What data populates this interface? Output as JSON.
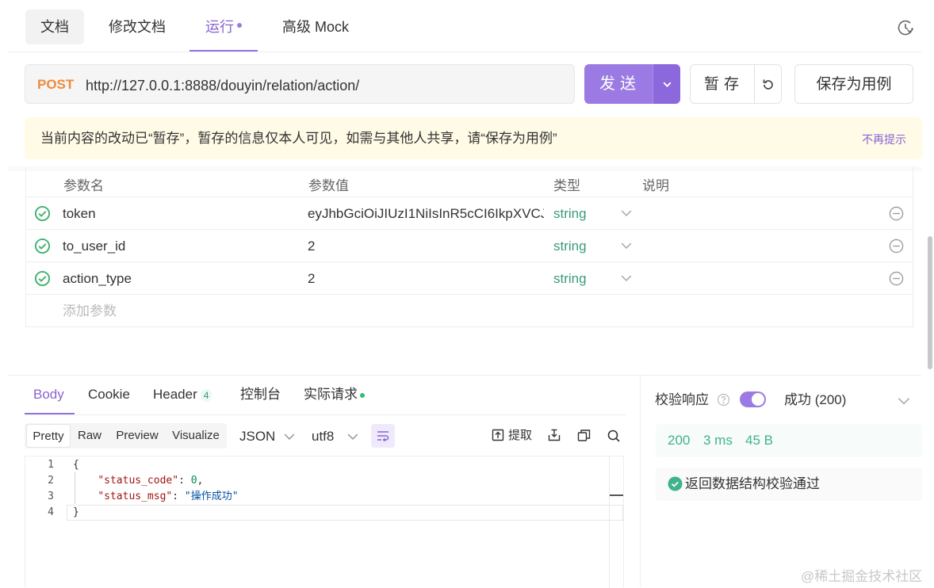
{
  "top_tabs": {
    "doc": "文档",
    "edit_doc": "修改文档",
    "run": "运行",
    "mock": "高级 Mock",
    "history_icon": "history-clock-icon"
  },
  "request": {
    "method": "POST",
    "url": "http://127.0.0.1:8888/douyin/relation/action/",
    "send_label": "发送",
    "stash_label": "暂存",
    "save_case_label": "保存为用例"
  },
  "notice": {
    "text": "当前内容的改动已“暂存”，暂存的信息仅本人可见，如需与其他人共享，请“保存为用例”",
    "dismiss": "不再提示"
  },
  "params": {
    "headers": {
      "name": "参数名",
      "value": "参数值",
      "type": "类型",
      "desc": "说明"
    },
    "rows": [
      {
        "name": "token",
        "value": "eyJhbGciOiJIUzI1NiIsInR5cCI6IkpXVCJ",
        "type": "string"
      },
      {
        "name": "to_user_id",
        "value": "2",
        "type": "string"
      },
      {
        "name": "action_type",
        "value": "2",
        "type": "string"
      }
    ],
    "add_placeholder": "添加参数"
  },
  "response_tabs": {
    "body": "Body",
    "cookie": "Cookie",
    "header": "Header",
    "header_count": "4",
    "console": "控制台",
    "actual_request": "实际请求"
  },
  "format_bar": {
    "pretty": "Pretty",
    "raw": "Raw",
    "preview": "Preview",
    "visualize": "Visualize",
    "format_select": "JSON",
    "encoding_select": "utf8",
    "extract_label": "提取"
  },
  "code": {
    "line_numbers": [
      "1",
      "2",
      "3",
      "4"
    ],
    "open_brace": "{",
    "key1": "\"status_code\"",
    "val1": "0",
    "key2": "\"status_msg\"",
    "val2": "\"操作成功\"",
    "close_brace": "}"
  },
  "validation": {
    "label": "校验响应",
    "enabled": true,
    "status": "成功 (200)",
    "status_code": "200",
    "time": "3 ms",
    "size": "45 B",
    "result": "返回数据结构校验通过"
  },
  "watermark": "@稀土掘金技术社区",
  "colors": {
    "accent": "#9b7be3",
    "method_post": "#f08a3c",
    "string_type": "#3a9a7a",
    "success": "#3fb38a",
    "notice_bg": "#fffbe6"
  }
}
